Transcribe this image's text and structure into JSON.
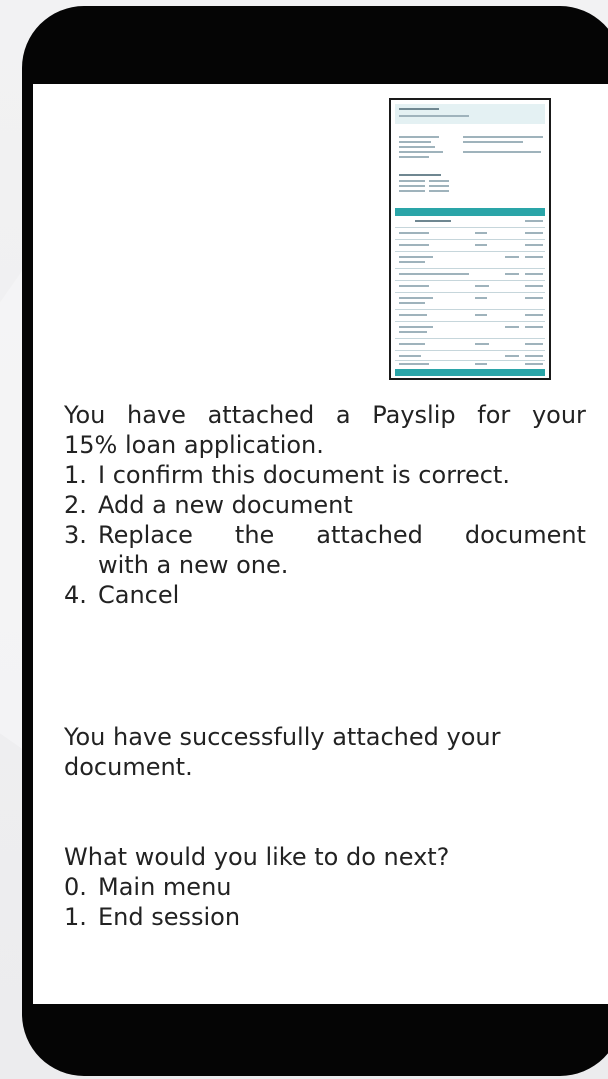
{
  "message_1": {
    "intro_line_1": [
      "You",
      "have",
      "attached",
      "a",
      "Payslip",
      "for",
      "your"
    ],
    "intro_line_2": "15% loan application.",
    "options": [
      {
        "num": "1.",
        "text": "I confirm this document is correct."
      },
      {
        "num": "2.",
        "text": "Add a new document"
      },
      {
        "num": "3.",
        "words": [
          "Replace",
          "the",
          "attached",
          "document"
        ],
        "cont": "with a new one."
      },
      {
        "num": "4.",
        "text": "Cancel"
      }
    ]
  },
  "message_2": {
    "line_1": "You have successfully attached your",
    "line_2": "document."
  },
  "message_3": {
    "question": "What would you like to do next?",
    "options": [
      {
        "num": "0.",
        "text": "Main menu"
      },
      {
        "num": "1.",
        "text": "End session"
      }
    ]
  },
  "attachment": {
    "kind": "payslip-document-preview"
  },
  "colors": {
    "phone_frame": "#050505",
    "screen": "#ffffff",
    "text": "#222222",
    "doc_accent": "#2aa5a8"
  }
}
